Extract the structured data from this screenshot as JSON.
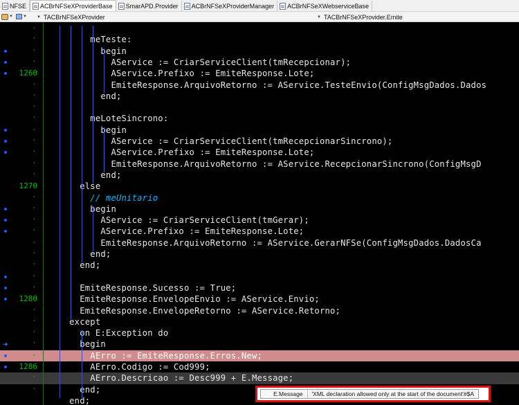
{
  "tabs": [
    {
      "label": "NFSE",
      "active": false
    },
    {
      "label": "ACBrNFSeXProviderBase",
      "active": true
    },
    {
      "label": "SmarAPD.Provider",
      "active": false
    },
    {
      "label": "ACBrNFSeXProviderManager",
      "active": false
    },
    {
      "label": "ACBrNFSeXWebserviceBase",
      "active": false
    }
  ],
  "navigator": {
    "class_label": "TACBrNFSeXProvider",
    "method_label": "TACBrNFSeXProvider.Emite"
  },
  "gutter": [
    {
      "num": "",
      "mark": "-",
      "dot": false
    },
    {
      "num": "",
      "mark": "·",
      "dot": false
    },
    {
      "num": "",
      "mark": "·",
      "dot": true
    },
    {
      "num": "",
      "mark": "·",
      "dot": true
    },
    {
      "num": "1260",
      "mark": "",
      "dot": true
    },
    {
      "num": "",
      "mark": "·",
      "dot": false
    },
    {
      "num": "",
      "mark": "·",
      "dot": false
    },
    {
      "num": "",
      "mark": "·",
      "dot": false
    },
    {
      "num": "",
      "mark": "·",
      "dot": false
    },
    {
      "num": "",
      "mark": "-",
      "dot": true
    },
    {
      "num": "",
      "mark": "·",
      "dot": true
    },
    {
      "num": "",
      "mark": "·",
      "dot": true
    },
    {
      "num": "",
      "mark": "·",
      "dot": false
    },
    {
      "num": "",
      "mark": "·",
      "dot": false
    },
    {
      "num": "1270",
      "mark": "",
      "dot": false
    },
    {
      "num": "",
      "mark": "·",
      "dot": false
    },
    {
      "num": "",
      "mark": "·",
      "dot": true
    },
    {
      "num": "",
      "mark": "·",
      "dot": true
    },
    {
      "num": "",
      "mark": "·",
      "dot": true
    },
    {
      "num": "",
      "mark": "-",
      "dot": false
    },
    {
      "num": "",
      "mark": "·",
      "dot": false
    },
    {
      "num": "",
      "mark": "·",
      "dot": false
    },
    {
      "num": "",
      "mark": "·",
      "dot": true
    },
    {
      "num": "",
      "mark": "·",
      "dot": true
    },
    {
      "num": "1280",
      "mark": "",
      "dot": true
    },
    {
      "num": "",
      "mark": "·",
      "dot": false
    },
    {
      "num": "",
      "mark": "·",
      "dot": false
    },
    {
      "num": "",
      "mark": "·",
      "dot": false
    },
    {
      "num": "",
      "mark": "·",
      "dot": false,
      "arrow": true
    },
    {
      "num": "",
      "mark": "-",
      "dot": true
    },
    {
      "num": "1286",
      "mark": "",
      "dot": true
    },
    {
      "num": "",
      "mark": "·",
      "dot": false
    },
    {
      "num": "",
      "mark": "·",
      "dot": false
    }
  ],
  "code_lines": [
    "",
    "        meTeste:",
    "          begin",
    "            AService := CriarServiceClient(tmRecepcionar);",
    "            AService.Prefixo := EmiteResponse.Lote;",
    "            EmiteResponse.ArquivoRetorno := AService.TesteEnvio(ConfigMsgDados.Dados",
    "          end;",
    "",
    "        meLoteSincrono:",
    "          begin",
    "            AService := CriarServiceClient(tmRecepcionarSincrono);",
    "            AService.Prefixo := EmiteResponse.Lote;",
    "            EmiteResponse.ArquivoRetorno := AService.RecepcionarSincrono(ConfigMsgD",
    "          end;",
    "      else",
    "        // meUnitario",
    "        begin",
    "          AService := CriarServiceClient(tmGerar);",
    "          AService.Prefixo := EmiteResponse.Lote;",
    "          EmiteResponse.ArquivoRetorno := AService.GerarNFSe(ConfigMsgDados.DadosCa",
    "        end;",
    "      end;",
    "",
    "      EmiteResponse.Sucesso := True;",
    "      EmiteResponse.EnvelopeEnvio := AService.Envio;",
    "      EmiteResponse.EnvelopeRetorno := AService.Retorno;",
    "    except",
    "      on E:Exception do",
    "      begin",
    "        AErro := EmiteResponse.Erros.New;",
    "        AErro.Codigo := Cod999;",
    "        AErro.Descricao := Desc999 + E.Message;",
    "      end;",
    "    end;"
  ],
  "tooltip": {
    "name": "E.Message",
    "value": "'XML declaration allowed only at the start of the document'#$A"
  }
}
